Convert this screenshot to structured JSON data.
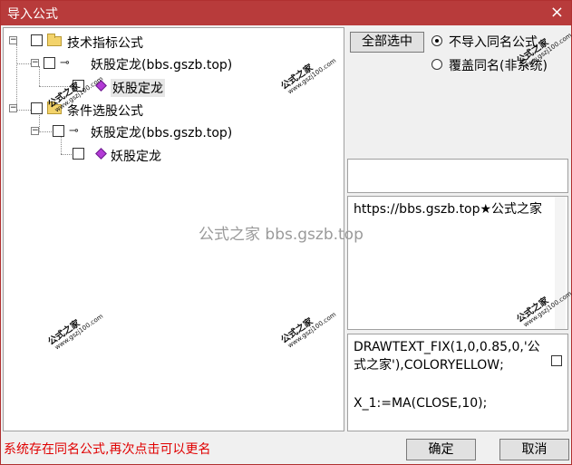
{
  "window": {
    "title": "导入公式",
    "close_icon": "×"
  },
  "tree": {
    "nodes": [
      {
        "label": "技术指标公式",
        "type": "folder"
      },
      {
        "label": "妖股定龙(bbs.gszb.top)",
        "type": "key"
      },
      {
        "label": "妖股定龙",
        "type": "formula"
      },
      {
        "label": "条件选股公式",
        "type": "folder"
      },
      {
        "label": "妖股定龙(bbs.gszb.top)",
        "type": "key"
      },
      {
        "label": "妖股定龙",
        "type": "formula"
      }
    ]
  },
  "controls": {
    "select_all_label": "全部选中",
    "radio_no_import": "不导入同名公式",
    "radio_overwrite": "覆盖同名(非系统)",
    "selected_option": "不导入同名公式"
  },
  "info": {
    "description": "https://bbs.gszb.top★公式之家",
    "code_line1": "DRAWTEXT_FIX(1,0,0.85,0,'公式之家'),COLORYELLOW;",
    "code_line2": "X_1:=MA(CLOSE,10);"
  },
  "footer": {
    "status_text": "系统存在同名公式,再次点击可以更名",
    "ok_label": "确定",
    "cancel_label": "取消"
  },
  "watermark": {
    "center": "公式之家 bbs.gszb.top",
    "small_cn": "公式之家",
    "small_url": "www.gszj100.com"
  },
  "colors": {
    "titlebar": "#b83b3b",
    "status": "#e00000"
  }
}
